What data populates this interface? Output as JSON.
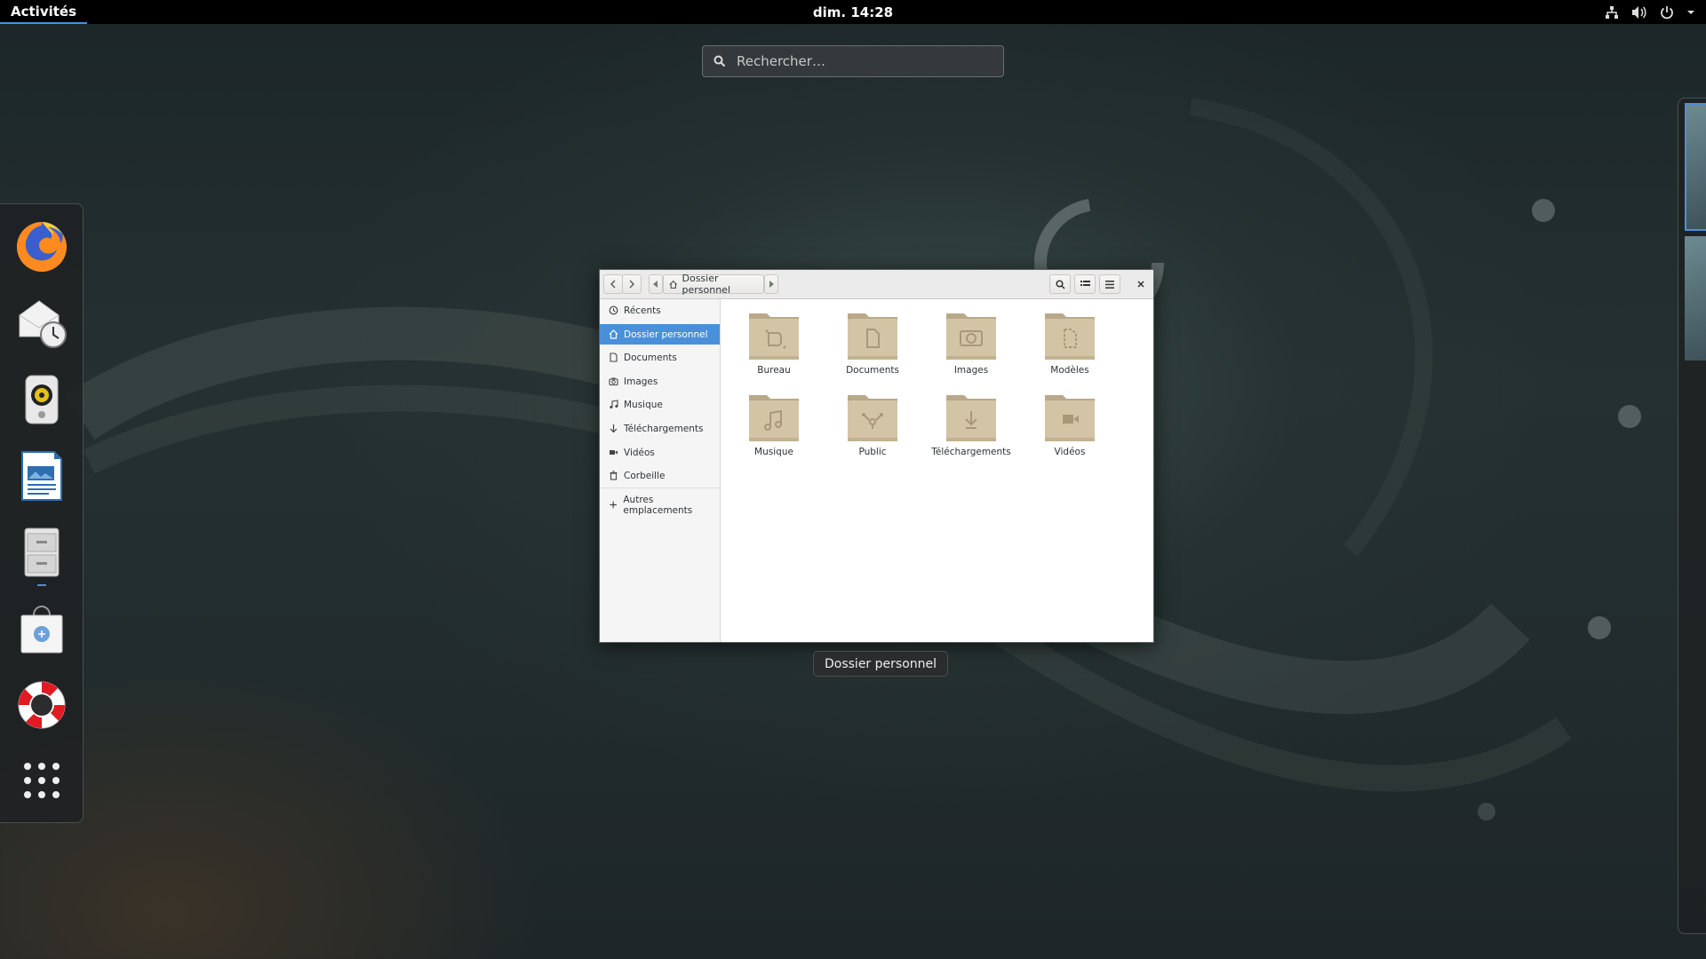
{
  "topbar": {
    "activities": "Activités",
    "clock": "dim. 14:28",
    "tray_icons": [
      "network-wired-icon",
      "volume-icon",
      "power-icon",
      "menu-arrow-icon"
    ]
  },
  "search": {
    "placeholder": "Rechercher…"
  },
  "dash": {
    "apps": [
      {
        "name": "firefox",
        "icon": "firefox-icon"
      },
      {
        "name": "evolution",
        "icon": "mail-clock-icon"
      },
      {
        "name": "rhythmbox",
        "icon": "speaker-icon"
      },
      {
        "name": "writer",
        "icon": "document-writer-icon"
      },
      {
        "name": "files",
        "icon": "file-cabinet-icon",
        "running": true
      },
      {
        "name": "software",
        "icon": "shopping-bag-icon"
      },
      {
        "name": "help",
        "icon": "lifebuoy-icon"
      },
      {
        "name": "show-apps",
        "icon": "app-grid-icon"
      }
    ]
  },
  "window": {
    "path": "Dossier personnel",
    "sidebar": [
      {
        "label": "Récents",
        "icon": "clock-icon"
      },
      {
        "label": "Dossier personnel",
        "icon": "home-icon",
        "active": true
      },
      {
        "label": "Documents",
        "icon": "document-icon"
      },
      {
        "label": "Images",
        "icon": "camera-icon"
      },
      {
        "label": "Musique",
        "icon": "music-icon"
      },
      {
        "label": "Téléchargements",
        "icon": "download-icon"
      },
      {
        "label": "Vidéos",
        "icon": "video-icon"
      },
      {
        "label": "Corbeille",
        "icon": "trash-icon"
      },
      {
        "label": "Autres emplacements",
        "icon": "plus-icon"
      }
    ],
    "folders": [
      {
        "label": "Bureau",
        "emblem": "desktop"
      },
      {
        "label": "Documents",
        "emblem": "document"
      },
      {
        "label": "Images",
        "emblem": "camera"
      },
      {
        "label": "Modèles",
        "emblem": "template"
      },
      {
        "label": "Musique",
        "emblem": "music"
      },
      {
        "label": "Public",
        "emblem": "share"
      },
      {
        "label": "Téléchargements",
        "emblem": "download"
      },
      {
        "label": "Vidéos",
        "emblem": "video"
      }
    ]
  },
  "tooltip": "Dossier personnel",
  "colors": {
    "accent": "#4a90d9",
    "folder": "#d3c4a6"
  }
}
